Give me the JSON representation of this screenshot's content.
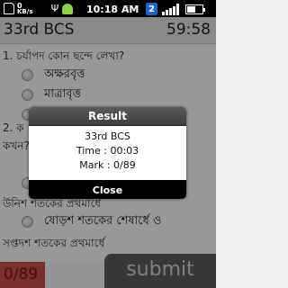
{
  "status_bar": {
    "kb_value": "0",
    "kb_unit": "KB/s",
    "usb_symbol": "Ψ",
    "time": "10:18 AM",
    "edge": "E",
    "network_badge": "2",
    "battery_level": 0.55
  },
  "header": {
    "title": "33rd BCS",
    "timer": "59:58"
  },
  "questions": [
    {
      "text": "1. চর্যাপদ কোন ছন্দে লেখা?",
      "options": [
        "অক্ষরবৃত্ত",
        "মাত্রাবৃত্ত",
        ""
      ]
    },
    {
      "text_fragments": [
        "2. ক",
        "কখন?"
      ],
      "options": [
        "উনিশ শতকের প্রথমার্ধে",
        "ষোড়শ শতকের শেষার্ধে ও",
        "সপ্তদশ শতকের প্রথমার্ধে"
      ]
    }
  ],
  "dialog": {
    "title": "Result",
    "exam_name": "33rd BCS",
    "time_line": "Time : 00:03",
    "mark_line": "Mark : 0/89",
    "close_label": "Close"
  },
  "footer": {
    "score": "0/89",
    "submit_label": "submit"
  },
  "colors": {
    "score_bg": "#c94a4a",
    "submit_bg": "#5a5a5a",
    "dialog_title_bg": "#4a4a4a"
  }
}
